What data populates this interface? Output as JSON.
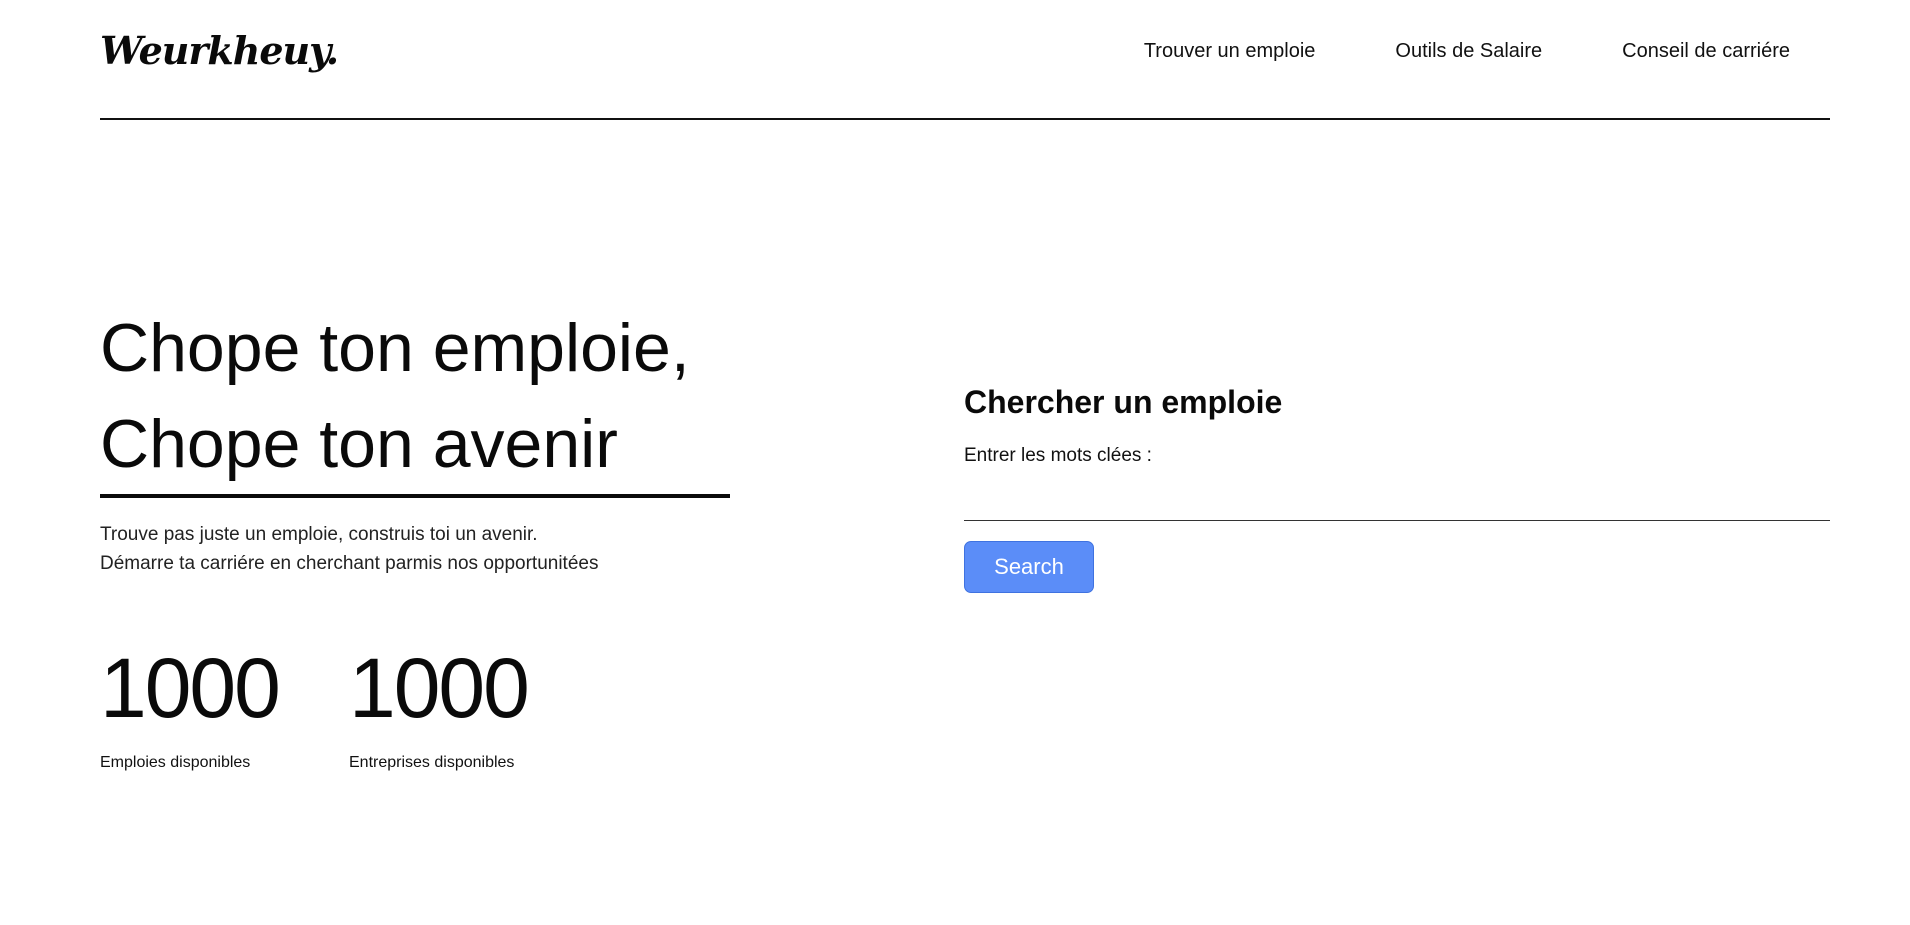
{
  "header": {
    "logo": "Weurkheuy.",
    "nav": [
      {
        "label": "Trouver un emploie"
      },
      {
        "label": "Outils de Salaire"
      },
      {
        "label": "Conseil de carriére"
      }
    ]
  },
  "hero": {
    "title_line1": "Chope ton emploie,",
    "title_line2": "Chope ton avenir",
    "subtitle_line1": "Trouve pas juste un emploie, construis toi un avenir.",
    "subtitle_line2": "Démarre ta carriére en cherchant parmis nos opportunitées",
    "stats": [
      {
        "value": "1000",
        "label": "Emploies disponibles"
      },
      {
        "value": "1000",
        "label": "Entreprises disponibles"
      }
    ]
  },
  "search": {
    "title": "Chercher un emploie",
    "label": "Entrer les mots clées :",
    "value": "",
    "button_label": "Search",
    "button_color": "#5b8df8"
  }
}
